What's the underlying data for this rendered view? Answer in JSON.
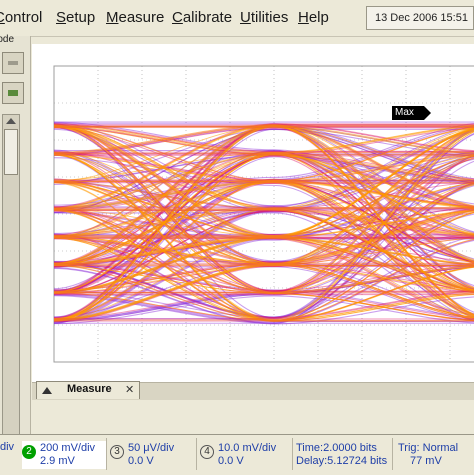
{
  "menubar": {
    "items": [
      {
        "label": "Control",
        "ul": "C",
        "rest": "ontrol"
      },
      {
        "label": "Setup",
        "ul": "S",
        "rest": "etup"
      },
      {
        "label": "Measure",
        "ul": "M",
        "rest": "easure"
      },
      {
        "label": "Calibrate",
        "ul": "C",
        "rest": "alibrate"
      },
      {
        "label": "Utilities",
        "ul": "U",
        "rest": "tilities"
      },
      {
        "label": "Help",
        "ul": "H",
        "rest": "elp"
      }
    ],
    "datetime": "13 Dec 2006   15:51"
  },
  "left_panel": {
    "mode_label": "Mode"
  },
  "display": {
    "marker_label": "Max",
    "colors": {
      "grid": "#9c9c9c",
      "hot": "#ff9900",
      "warm": "#e0206a",
      "cool": "#8a2bd6"
    }
  },
  "measure_tab": {
    "label": "Measure",
    "close": "✕"
  },
  "status": {
    "channels": [
      {
        "num": "2",
        "line1": "200 mV/div",
        "line2": "2.9 mV",
        "color": "#00a000",
        "active": true
      },
      {
        "num": "3",
        "line1": "50 μV/div",
        "line2": "0.0 V",
        "color": "#555555",
        "active": false
      },
      {
        "num": "4",
        "line1": "10.0 mV/div",
        "line2": "0.0 V",
        "color": "#555555",
        "active": false
      }
    ],
    "timebase": {
      "line1": "Time:2.0000 bits",
      "line2": "Delay:5.12724 bits"
    },
    "trigger": {
      "line1": "Trig: Normal",
      "line2": "77 mV"
    },
    "partial_left": "div"
  }
}
